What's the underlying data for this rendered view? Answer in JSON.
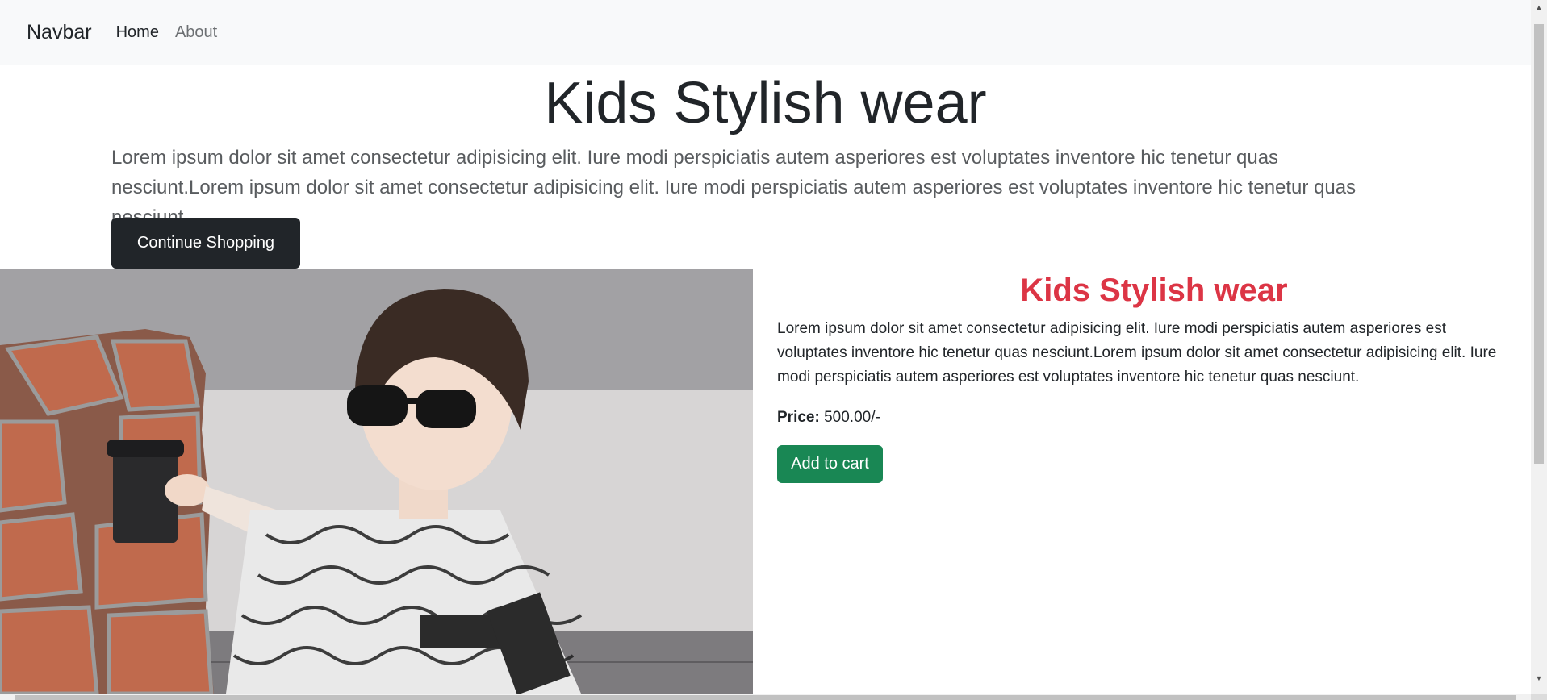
{
  "navbar": {
    "brand": "Navbar",
    "links": [
      {
        "label": "Home",
        "active": true
      },
      {
        "label": "About",
        "active": false
      }
    ]
  },
  "hero": {
    "title": "Kids Stylish wear",
    "description": "Lorem ipsum dolor sit amet consectetur adipisicing elit. Iure modi perspiciatis autem asperiores est voluptates inventore hic tenetur quas nesciunt.Lorem ipsum dolor sit amet consectetur adipisicing elit. Iure modi perspiciatis autem asperiores est voluptates inventore hic tenetur quas nesciunt.",
    "button_label": "Continue Shopping"
  },
  "product": {
    "image_alt": "Boy wearing sunglasses holding a coffee cup",
    "title": "Kids Stylish wear",
    "description": "Lorem ipsum dolor sit amet consectetur adipisicing elit. Iure modi perspiciatis autem asperiores est voluptates inventore hic tenetur quas nesciunt.Lorem ipsum dolor sit amet consectetur adipisicing elit. Iure modi perspiciatis autem asperiores est voluptates inventore hic tenetur quas nesciunt.",
    "price_label": "Price:",
    "price_value": "500.00/-",
    "add_to_cart_label": "Add to cart"
  },
  "colors": {
    "navbar_bg": "#f8f9fa",
    "dark_button": "#212529",
    "success_button": "#198754",
    "title_red": "#dc3545"
  }
}
